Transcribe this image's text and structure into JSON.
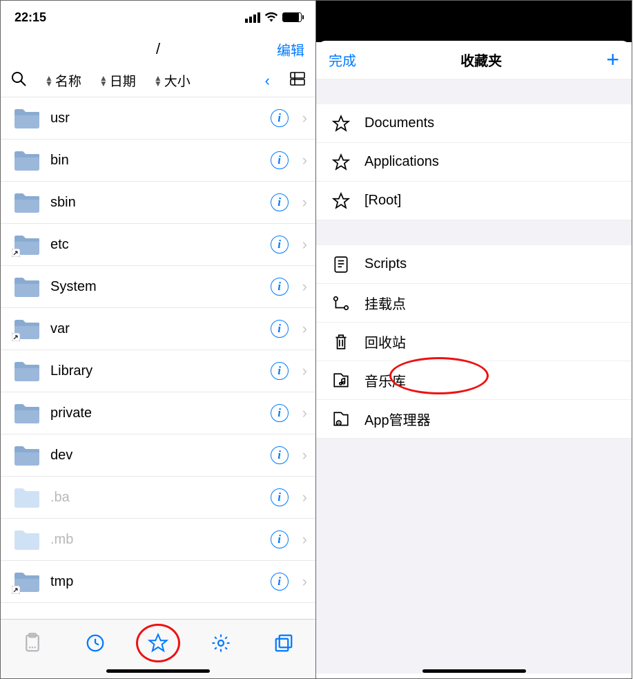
{
  "left": {
    "statusbar": {
      "time": "22:15"
    },
    "navbar": {
      "title": "/",
      "edit": "编辑"
    },
    "sortbar": {
      "col_name": "名称",
      "col_date": "日期",
      "col_size": "大小"
    },
    "files": [
      {
        "name": "usr",
        "alias": false,
        "dim": false
      },
      {
        "name": "bin",
        "alias": false,
        "dim": false
      },
      {
        "name": "sbin",
        "alias": false,
        "dim": false
      },
      {
        "name": "etc",
        "alias": true,
        "dim": false
      },
      {
        "name": "System",
        "alias": false,
        "dim": false
      },
      {
        "name": "var",
        "alias": true,
        "dim": false
      },
      {
        "name": "Library",
        "alias": false,
        "dim": false
      },
      {
        "name": "private",
        "alias": false,
        "dim": false
      },
      {
        "name": "dev",
        "alias": false,
        "dim": false
      },
      {
        "name": ".ba",
        "alias": false,
        "dim": true
      },
      {
        "name": ".mb",
        "alias": false,
        "dim": true
      },
      {
        "name": "tmp",
        "alias": true,
        "dim": false
      }
    ]
  },
  "right": {
    "nav": {
      "done": "完成",
      "title": "收藏夹"
    },
    "group1": [
      {
        "label": "Documents",
        "icon": "star"
      },
      {
        "label": "Applications",
        "icon": "star"
      },
      {
        "label": "[Root]",
        "icon": "star"
      }
    ],
    "group2": [
      {
        "label": "Scripts",
        "icon": "script"
      },
      {
        "label": "挂载点",
        "icon": "mount"
      },
      {
        "label": "回收站",
        "icon": "trash"
      },
      {
        "label": "音乐库",
        "icon": "music"
      },
      {
        "label": "App管理器",
        "icon": "appmgr"
      }
    ]
  }
}
